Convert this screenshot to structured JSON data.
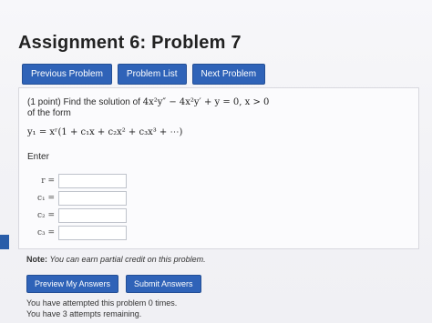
{
  "page": {
    "title": "Assignment 6: Problem 7"
  },
  "navigation": {
    "previous": "Previous Problem",
    "list": "Problem List",
    "next": "Next Problem"
  },
  "problem": {
    "points": "(1 point) Find the solution of",
    "equation": "4x²y″ − 4x²y′ + y = 0, x > 0",
    "form_text": "of the form",
    "series_form": "y₁ = xʳ(1 + c₁x + c₂x² + c₃x³ + ⋯)",
    "enter": "Enter"
  },
  "answers": [
    {
      "label": "r =",
      "value": ""
    },
    {
      "label": "c₁ =",
      "value": ""
    },
    {
      "label": "c₂ =",
      "value": ""
    },
    {
      "label": "c₃ =",
      "value": ""
    }
  ],
  "note": {
    "prefix": "Note:",
    "text": "You can earn partial credit on this problem."
  },
  "actions": {
    "preview": "Preview My Answers",
    "submit": "Submit Answers"
  },
  "status": {
    "attempted": "You have attempted this problem 0 times.",
    "remaining": "You have 3 attempts remaining."
  }
}
